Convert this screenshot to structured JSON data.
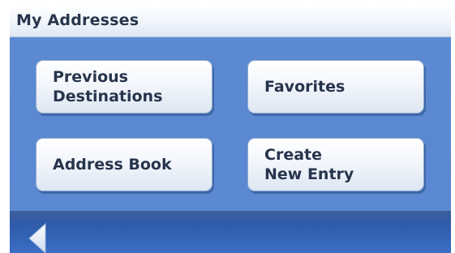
{
  "header": {
    "title": "My Addresses"
  },
  "buttons": {
    "previous_destinations": "Previous\nDestinations",
    "favorites": "Favorites",
    "address_book": "Address Book",
    "create_new_entry": "Create\nNew Entry"
  },
  "footer": {
    "back_icon": "back-arrow-icon"
  },
  "colors": {
    "title_text": "#28354d",
    "panel_blue": "#5a88d1",
    "footer_blue": "#3a6ec5"
  }
}
